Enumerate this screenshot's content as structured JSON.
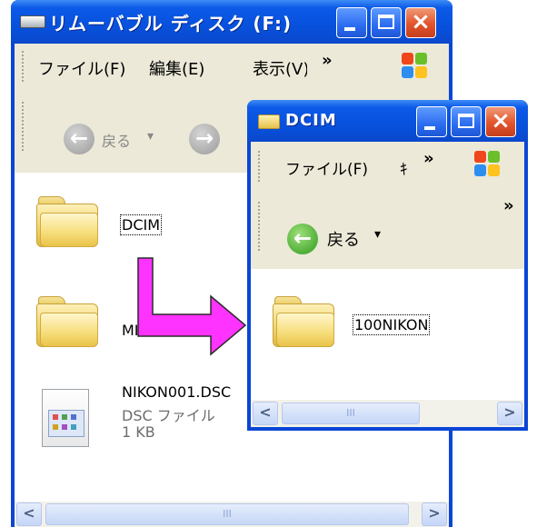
{
  "back_window": {
    "title": "リムーバブル ディスク (F:)",
    "menu": [
      "ファイル(F)",
      "編集(E)",
      "表示(V)"
    ],
    "menu_more": "»",
    "toolbar": {
      "back_label": "戻る",
      "dropdown": "▾"
    },
    "items": [
      {
        "name": "DCIM",
        "type": "folder",
        "icon": "folder-icon"
      },
      {
        "name": "MISC",
        "type": "folder",
        "icon": "folder-icon"
      },
      {
        "name": "NIKON001.DSC",
        "type_label": "DSC ファイル",
        "size": "1 KB",
        "icon": "file-icon"
      }
    ],
    "scroll": {
      "left": "<",
      "right": ">",
      "thumb": "III"
    }
  },
  "front_window": {
    "title": "DCIM",
    "menu": [
      "ファイル(F)",
      "ｷ"
    ],
    "menu_more": "»",
    "toolbar": {
      "back_label": "戻る",
      "dropdown": "▾",
      "more": "»"
    },
    "items": [
      {
        "name": "100NIKON",
        "type": "folder",
        "icon": "folder-icon"
      }
    ],
    "scroll": {
      "left": "<",
      "right": ">",
      "thumb": "III"
    }
  },
  "colors": {
    "arrow": "#ff33ff",
    "title_blue": "#0a46d6",
    "close_red": "#e2542c"
  }
}
